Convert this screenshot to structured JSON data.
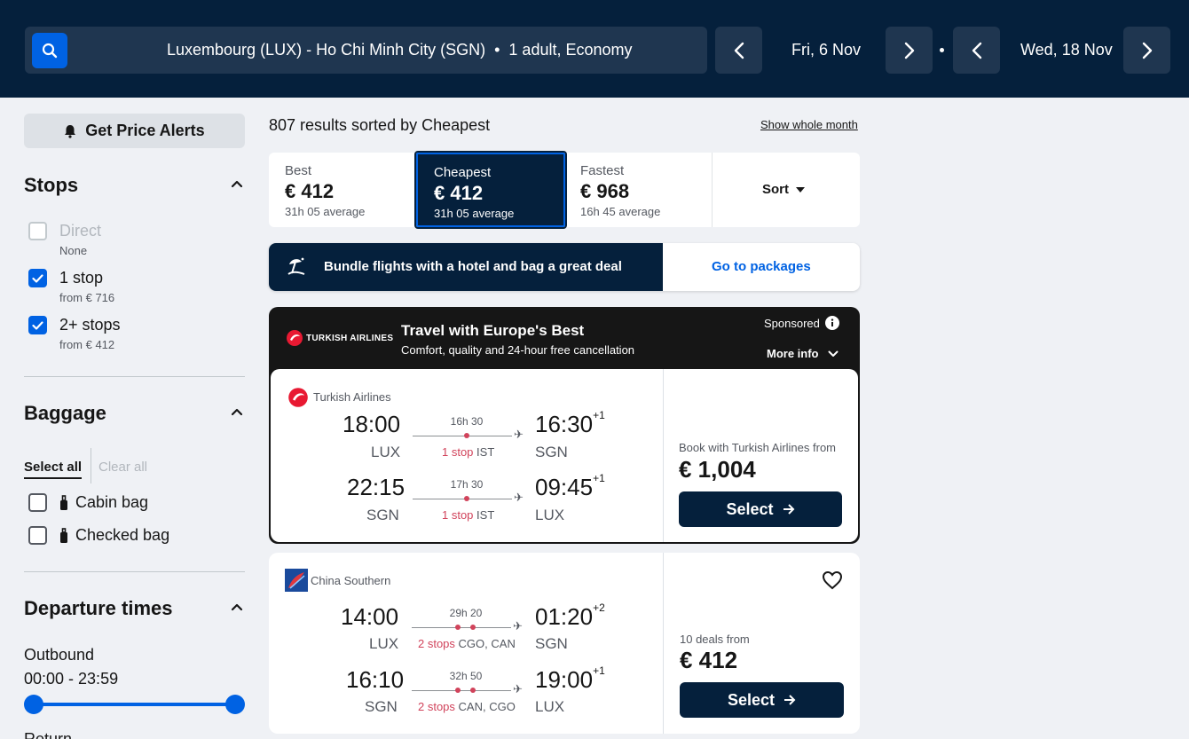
{
  "header": {
    "route": "Luxembourg (LUX) - Ho Chi Minh City (SGN)",
    "separator": "•",
    "travellers": "1 adult, Economy",
    "depart_date": "Fri, 6 Nov",
    "return_date": "Wed, 18 Nov",
    "icons": [
      "search-icon",
      "chevron-left-icon",
      "chevron-right-icon"
    ]
  },
  "sidebar": {
    "alerts_label": "Get Price Alerts",
    "stops": {
      "title": "Stops",
      "options": [
        {
          "label": "Direct",
          "sub": "None",
          "checked": false,
          "disabled": true
        },
        {
          "label": "1 stop",
          "sub": "from € 716",
          "checked": true,
          "disabled": false
        },
        {
          "label": "2+ stops",
          "sub": "from € 412",
          "checked": true,
          "disabled": false
        }
      ]
    },
    "baggage": {
      "title": "Baggage",
      "select_all": "Select all",
      "clear_all": "Clear all",
      "options": [
        {
          "label": "Cabin bag",
          "checked": false
        },
        {
          "label": "Checked bag",
          "checked": false
        }
      ]
    },
    "departure_times": {
      "title": "Departure times",
      "outbound_label": "Outbound",
      "outbound_range": "00:00 - 23:59",
      "outbound_slider": {
        "min_fraction": 0,
        "max_fraction": 1
      },
      "return_label": "Return"
    }
  },
  "results": {
    "summary": "807 results sorted by Cheapest",
    "show_whole_month": "Show whole month",
    "tabs": [
      {
        "label": "Best",
        "price": "€ 412",
        "avg": "31h 05 average",
        "active": false
      },
      {
        "label": "Cheapest",
        "price": "€ 412",
        "avg": "31h 05 average",
        "active": true
      },
      {
        "label": "Fastest",
        "price": "€ 968",
        "avg": "16h 45 average",
        "active": false
      }
    ],
    "sort_label": "Sort",
    "bundle": {
      "text": "Bundle flights with a hotel and bag a great deal",
      "link": "Go to packages"
    },
    "ad": {
      "logo_text": "TURKISH AIRLINES",
      "title": "Travel with Europe's Best",
      "subtitle": "Comfort, quality and 24-hour free cancellation",
      "sponsored": "Sponsored",
      "more_info": "More info",
      "airline": "Turkish Airlines",
      "legs": [
        {
          "dep_time": "18:00",
          "dep_code": "LUX",
          "duration": "16h 30",
          "stops_label": "1 stop",
          "stops_via": "IST",
          "arr_time": "16:30",
          "arr_offset": "+1",
          "arr_code": "SGN"
        },
        {
          "dep_time": "22:15",
          "dep_code": "SGN",
          "duration": "17h 30",
          "stops_label": "1 stop",
          "stops_via": "IST",
          "arr_time": "09:45",
          "arr_offset": "+1",
          "arr_code": "LUX"
        }
      ],
      "price_from": "Book with Turkish Airlines from",
      "price": "€ 1,004",
      "select": "Select"
    },
    "card": {
      "airline": "China Southern",
      "legs": [
        {
          "dep_time": "14:00",
          "dep_code": "LUX",
          "duration": "29h 20",
          "stops_label": "2 stops",
          "stops_via": "CGO, CAN",
          "arr_time": "01:20",
          "arr_offset": "+2",
          "arr_code": "SGN"
        },
        {
          "dep_time": "16:10",
          "dep_code": "SGN",
          "duration": "32h 50",
          "stops_label": "2 stops",
          "stops_via": "CAN, CGO",
          "arr_time": "19:00",
          "arr_offset": "+1",
          "arr_code": "LUX"
        }
      ],
      "price_from": "10 deals from",
      "price": "€ 412",
      "select": "Select"
    }
  },
  "colors": {
    "header_bg": "#05203c",
    "accent": "#0062e3",
    "stop_red": "#d1435b",
    "page_bg": "#eff1f5"
  }
}
